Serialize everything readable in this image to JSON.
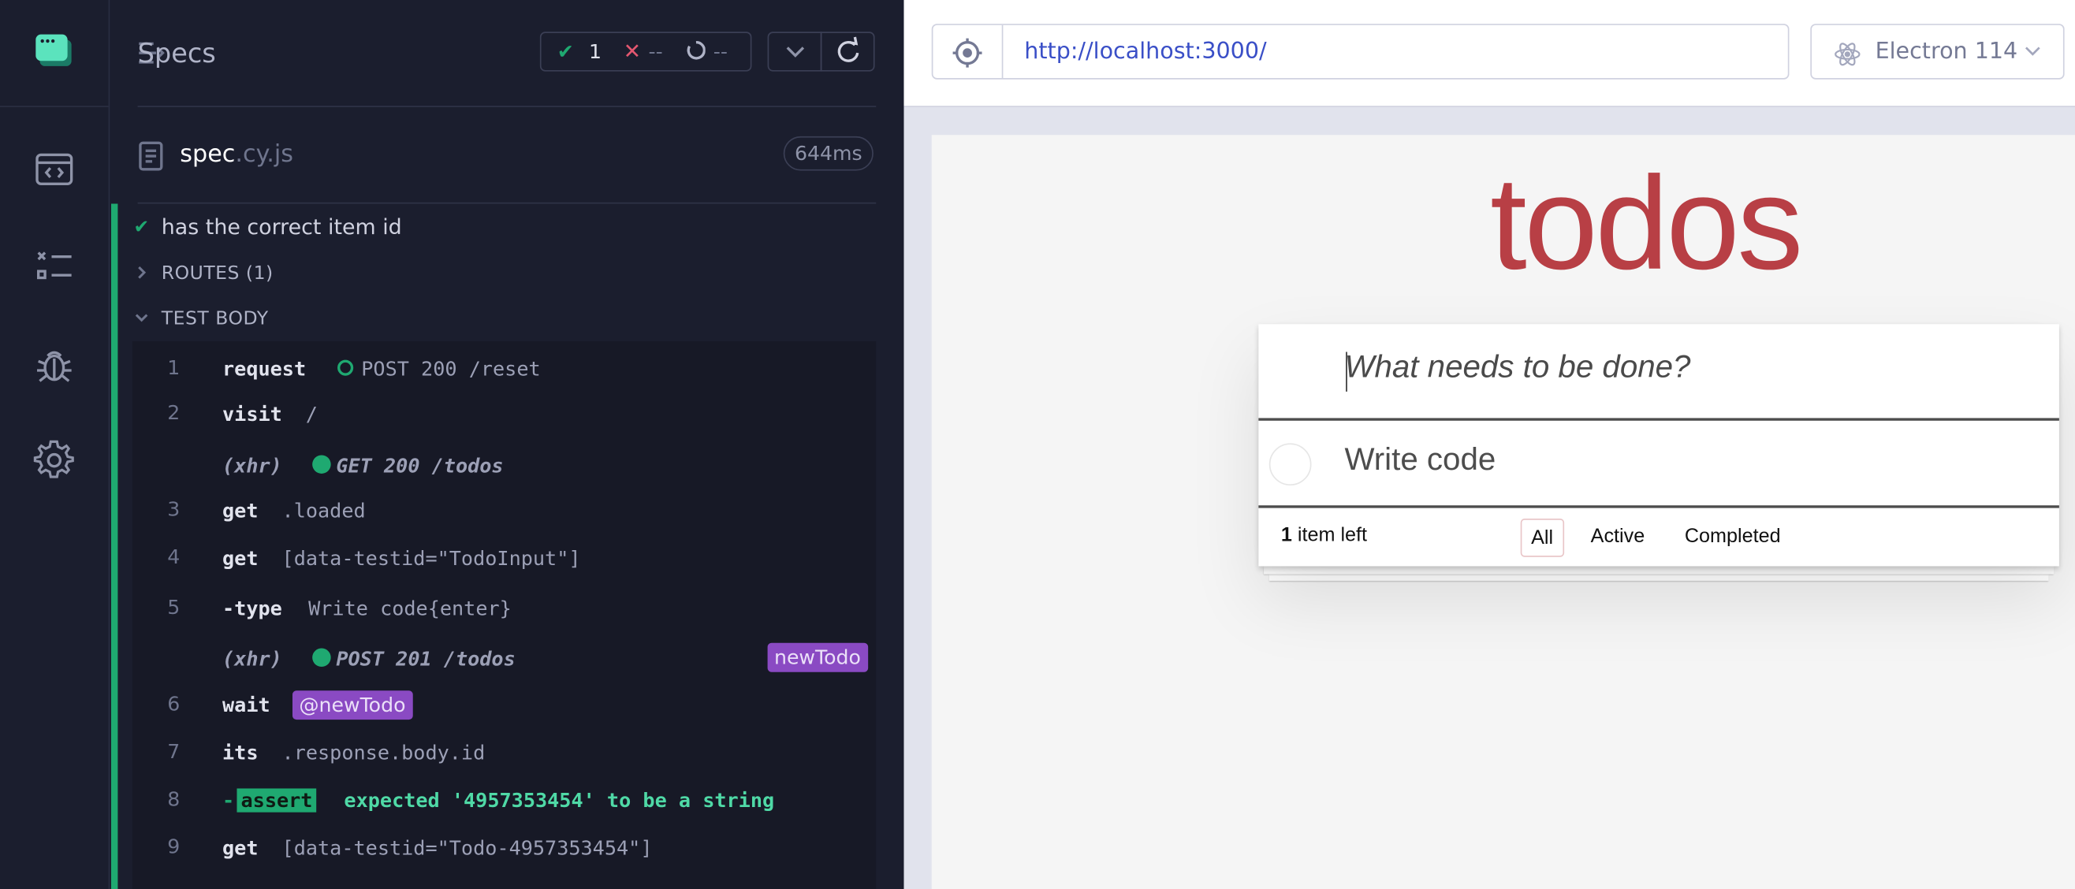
{
  "reporter": {
    "specs_label": "Specs",
    "stats": {
      "passed": "1",
      "failed": "--",
      "pending": "--"
    },
    "spec_file": {
      "name": "spec",
      "ext": ".cy.js",
      "duration": "644ms"
    },
    "test_title": "has the correct item id",
    "routes_label": "ROUTES (1)",
    "test_body_label": "TEST BODY",
    "commands": [
      {
        "num": "1",
        "name": "request",
        "msg": "POST 200 /reset"
      },
      {
        "num": "2",
        "name": "visit",
        "msg": "/"
      },
      {
        "num": "",
        "name": "(xhr)",
        "msg": "GET 200 /todos"
      },
      {
        "num": "3",
        "name": "get",
        "msg": ".loaded"
      },
      {
        "num": "4",
        "name": "get",
        "msg": "[data-testid=\"TodoInput\"]"
      },
      {
        "num": "5",
        "name": "-type",
        "msg": "Write code{enter}"
      },
      {
        "num": "",
        "name": "(xhr)",
        "msg": "POST 201 /todos",
        "alias": "newTodo"
      },
      {
        "num": "6",
        "name": "wait",
        "alias": "@newTodo"
      },
      {
        "num": "7",
        "name": "its",
        "msg": ".response.body.id"
      },
      {
        "num": "8",
        "name": "-",
        "badge": "assert",
        "msg": "expected '4957353454' to be a string"
      },
      {
        "num": "9",
        "name": "get",
        "msg": "[data-testid=\"Todo-4957353454\"]"
      }
    ]
  },
  "browser": {
    "url": "http://localhost:3000/",
    "selected_browser": "Electron 114"
  },
  "todo_app": {
    "title": "todos",
    "placeholder": "What needs to be done?",
    "items": [
      {
        "text": "Write code",
        "completed": false
      }
    ],
    "count_number": "1",
    "count_label": " item left",
    "filters": [
      "All",
      "Active",
      "Completed"
    ],
    "selected_filter": "All"
  },
  "colors": {
    "pass": "#1fa971",
    "fail": "#e45770",
    "alias": "#8a4ac3",
    "todo_title": "#b83f45",
    "url": "#3a4fc7"
  }
}
